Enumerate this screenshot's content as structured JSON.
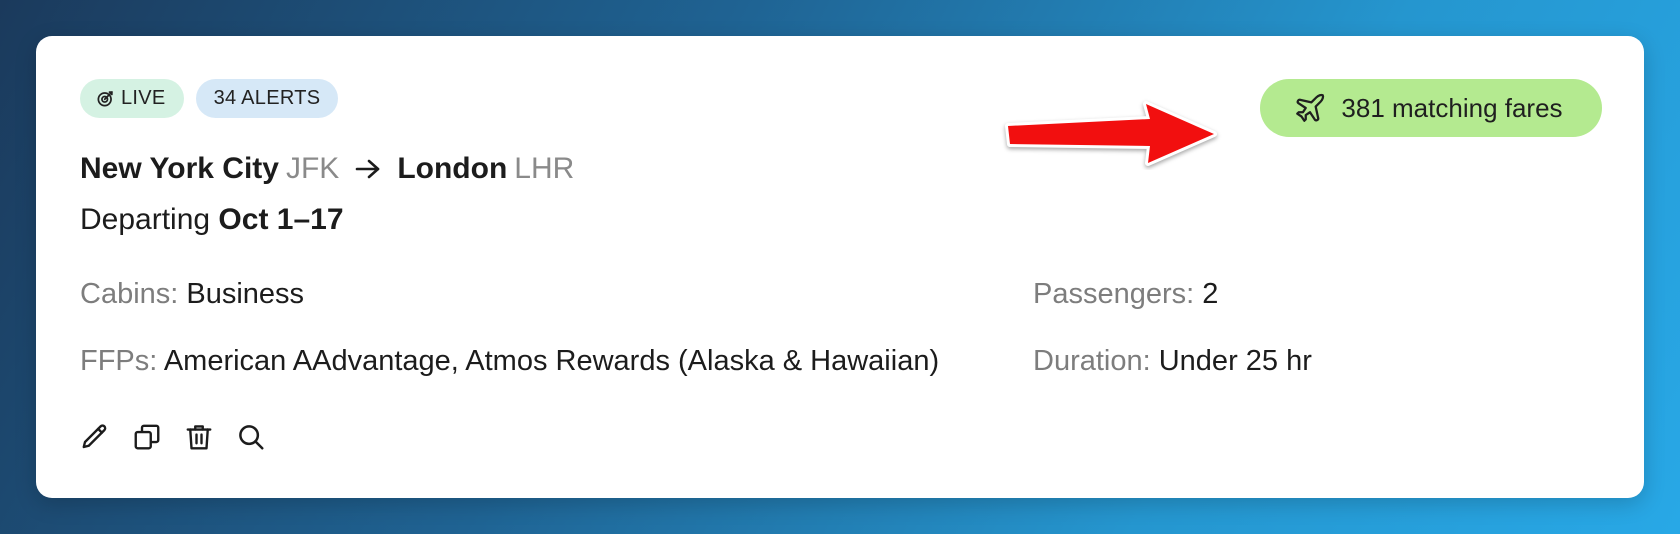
{
  "badges": {
    "live": "LIVE",
    "alerts": "34 ALERTS"
  },
  "matching": {
    "label": "381 matching fares"
  },
  "route": {
    "origin_city": "New York City",
    "origin_code": "JFK",
    "destination_city": "London",
    "destination_code": "LHR"
  },
  "departing": {
    "prefix": "Departing",
    "dates": "Oct 1–17"
  },
  "details": {
    "cabins_label": "Cabins:",
    "cabins_value": "Business",
    "passengers_label": "Passengers:",
    "passengers_value": "2",
    "ffps_label": "FFPs:",
    "ffps_value": "American AAdvantage, Atmos Rewards (Alaska & Hawaiian)",
    "duration_label": "Duration:",
    "duration_value": "Under 25 hr"
  },
  "icons": [
    "target-icon",
    "plane-icon",
    "pencil-icon",
    "copy-icon",
    "trash-icon",
    "search-icon"
  ],
  "colors": {
    "live_badge": "#d5f2e3",
    "alerts_badge": "#d6e8f7",
    "matching_pill": "#b4ea90",
    "annotation_arrow": "#f20f0f",
    "muted_text": "#7d7d7d"
  }
}
